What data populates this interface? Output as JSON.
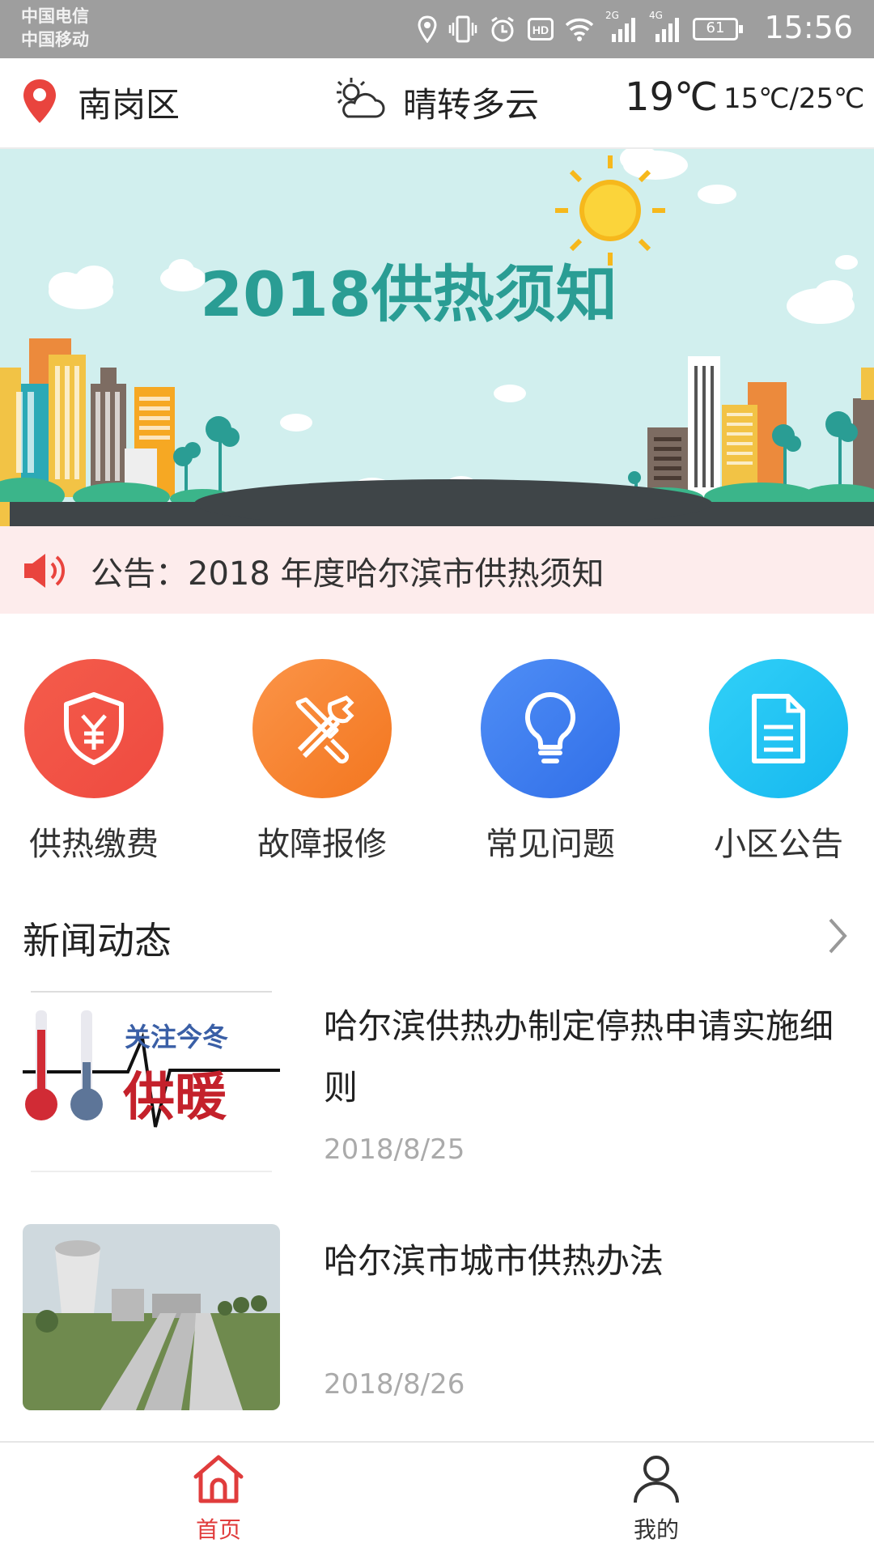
{
  "status_bar": {
    "carrier_1": "中国电信",
    "carrier_2": "中国移动",
    "signal_1_tag": "2G",
    "signal_2_tag": "4G",
    "battery": "61",
    "time": "15:56",
    "icons": [
      "location-icon",
      "vibrate-icon",
      "alarm-icon",
      "hd-icon",
      "wifi-icon",
      "signal-icon",
      "signal-icon",
      "battery-icon"
    ]
  },
  "header": {
    "district": "南岗区",
    "weather": "晴转多云",
    "temperature": "19℃",
    "temp_range": "15℃/25℃",
    "icons": [
      "location-pin-icon",
      "sun-cloud-icon"
    ]
  },
  "banner": {
    "title": "2018供热须知"
  },
  "notice": {
    "text": "公告：2018 年度哈尔滨市供热须知",
    "icon": "speaker-icon"
  },
  "quick_actions": [
    {
      "label": "供热缴费",
      "icon": "yuan-shield-icon",
      "color": "#f04c44"
    },
    {
      "label": "故障报修",
      "icon": "wrench-screwdriver-icon",
      "color": "#f7802a"
    },
    {
      "label": "常见问题",
      "icon": "lightbulb-icon",
      "color": "#3d7ff2"
    },
    {
      "label": "小区公告",
      "icon": "document-icon",
      "color": "#22c4f2"
    }
  ],
  "news": {
    "section_title": "新闻动态",
    "items": [
      {
        "title": "哈尔滨供热办制定停热申请实施细则",
        "date": "2018/8/25",
        "thumb_text_1": "关注今冬",
        "thumb_text_2": "供暖"
      },
      {
        "title": "哈尔滨市城市供热办法",
        "date": "2018/8/26"
      }
    ]
  },
  "tabbar": {
    "home_label": "首页",
    "mine_label": "我的",
    "active": "首页",
    "active_color": "#e03c3c",
    "inactive_color": "#333333"
  }
}
